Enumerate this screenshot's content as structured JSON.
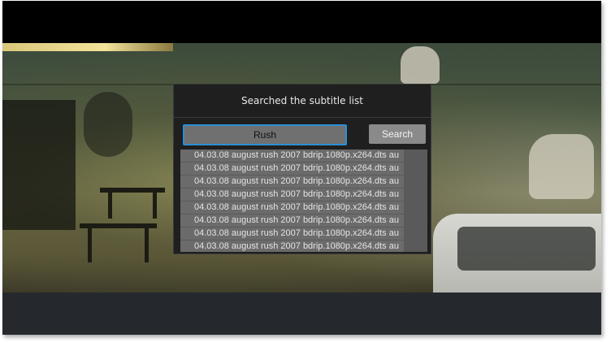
{
  "dialog": {
    "title": "Searched the subtitle list",
    "search_value": "Rush",
    "search_button_label": "Search",
    "results": [
      "04.03.08 august rush 2007 bdrip.1080p.x264.dts au",
      "04.03.08 august rush 2007 bdrip.1080p.x264.dts au",
      "04.03.08 august rush 2007 bdrip.1080p.x264.dts au",
      "04.03.08 august rush 2007 bdrip.1080p.x264.dts au",
      "04.03.08 august rush 2007 bdrip.1080p.x264.dts au",
      "04.03.08 august rush 2007 bdrip.1080p.x264.dts au",
      "04.03.08 august rush 2007 bdrip.1080p.x264.dts au",
      "04.03.08 august rush 2007 bdrip.1080p.x264.dts au"
    ]
  },
  "colors": {
    "focus_border": "#2b8fd6",
    "dialog_bg": "#1f1f1f",
    "row_bg": "#6b6b6b",
    "control_bar": "#25292e"
  }
}
